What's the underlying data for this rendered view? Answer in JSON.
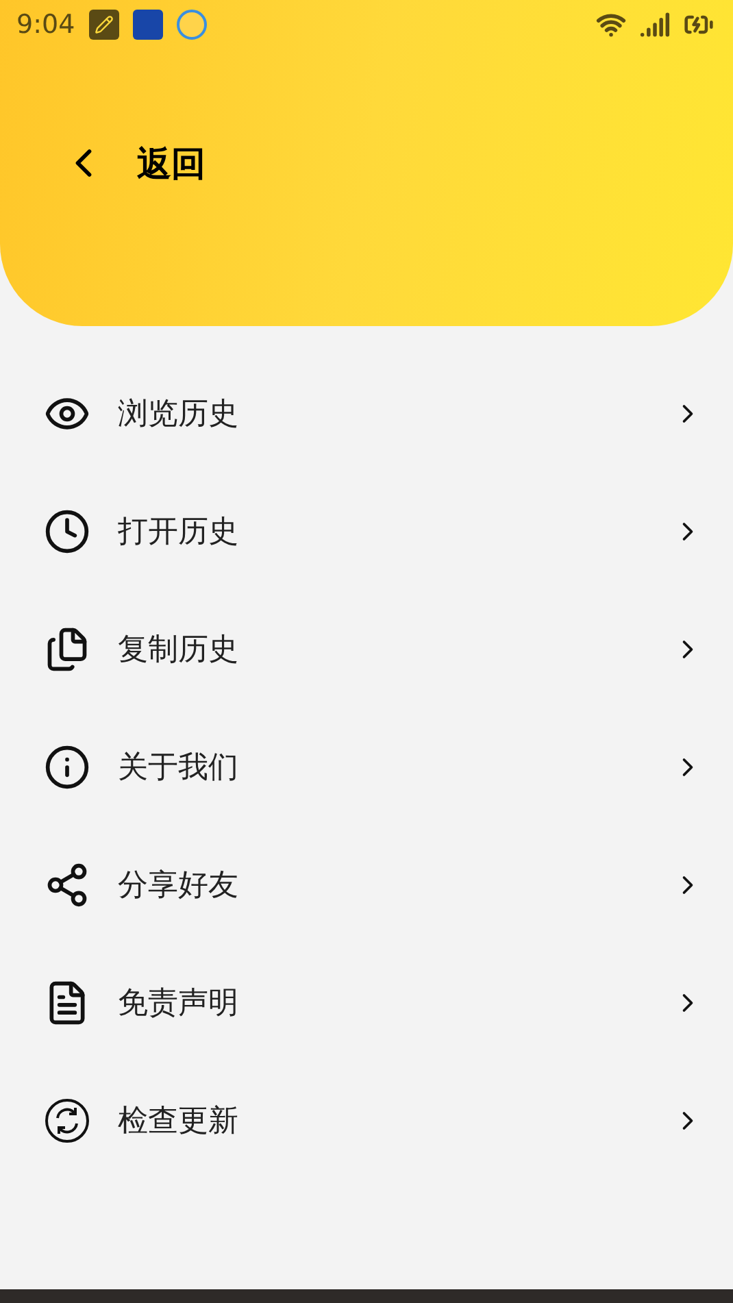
{
  "status_bar": {
    "time": "9:04"
  },
  "header": {
    "back_label": "返回"
  },
  "menu": [
    {
      "kind": "eye",
      "label": "浏览历史"
    },
    {
      "kind": "clock",
      "label": "打开历史"
    },
    {
      "kind": "copy",
      "label": "复制历史"
    },
    {
      "kind": "info",
      "label": "关于我们"
    },
    {
      "kind": "share",
      "label": "分享好友"
    },
    {
      "kind": "document",
      "label": "免责声明"
    },
    {
      "kind": "refresh",
      "label": "检查更新"
    }
  ]
}
